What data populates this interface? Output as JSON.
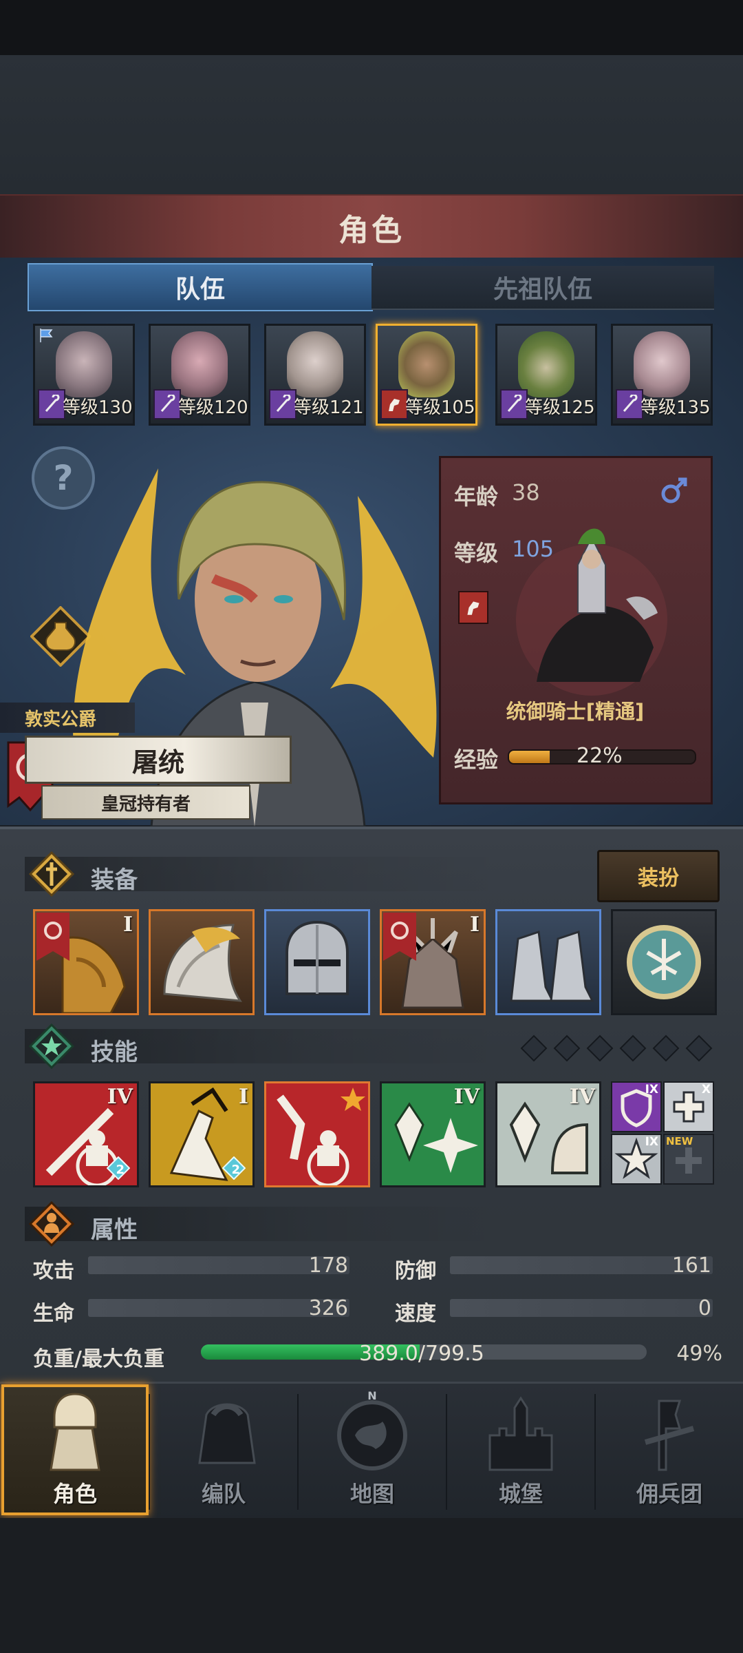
{
  "header": {
    "title": "角色"
  },
  "tabs": [
    {
      "label": "队伍",
      "active": true
    },
    {
      "label": "先祖队伍",
      "active": false
    }
  ],
  "team": [
    {
      "level": "等级130",
      "class_icon": "staff-icon",
      "selected": false,
      "flag": true
    },
    {
      "level": "等级120",
      "class_icon": "staff-icon",
      "selected": false,
      "flag": false
    },
    {
      "level": "等级121",
      "class_icon": "staff-icon",
      "selected": false,
      "flag": false
    },
    {
      "level": "等级105",
      "class_icon": "horse-icon",
      "selected": true,
      "flag": false
    },
    {
      "level": "等级125",
      "class_icon": "staff-icon",
      "selected": false,
      "flag": false
    },
    {
      "level": "等级135",
      "class_icon": "staff-icon",
      "selected": false,
      "flag": false
    }
  ],
  "hero": {
    "title": "敦实公爵",
    "name": "屠统",
    "subtitle": "皇冠持有者",
    "age_label": "年龄",
    "age": "38",
    "level_label": "等级",
    "level": "105",
    "class_name": "统御骑士[精通]",
    "exp_label": "经验",
    "exp_percent_text": "22%",
    "exp_fraction": 0.22
  },
  "equipment": {
    "title": "装备",
    "dress_button": "装扮",
    "items": [
      {
        "name": "dragon-armor",
        "tier": "I",
        "rarity": "orange"
      },
      {
        "name": "winged-shoulder",
        "tier": "",
        "rarity": "orange"
      },
      {
        "name": "knight-helmet",
        "tier": "",
        "rarity": "blue"
      },
      {
        "name": "spiked-armor",
        "tier": "I",
        "rarity": "orange"
      },
      {
        "name": "steel-boots",
        "tier": "",
        "rarity": "blue"
      },
      {
        "name": "emblem-medal",
        "tier": "",
        "rarity": "gray"
      }
    ]
  },
  "skills": {
    "title": "技能",
    "slots_total": 6,
    "items": [
      {
        "name": "sword-strike-skill",
        "tier": "IV",
        "badge": "2"
      },
      {
        "name": "broken-lance-skill",
        "tier": "I",
        "badge": "2"
      },
      {
        "name": "banner-rally-skill",
        "tier": "★",
        "badge": ""
      },
      {
        "name": "crystal-burst-skill",
        "tier": "IV",
        "badge": ""
      },
      {
        "name": "crystal-shield-skill",
        "tier": "IV",
        "badge": ""
      }
    ],
    "small": [
      {
        "name": "shield-passive",
        "tier": "IX"
      },
      {
        "name": "cross-passive",
        "tier": "X"
      },
      {
        "name": "burst-passive",
        "tier": "IX"
      },
      {
        "name": "new-empty-slot",
        "tier": "NEW"
      }
    ]
  },
  "attributes": {
    "title": "属性",
    "attack_label": "攻击",
    "attack": "178",
    "defense_label": "防御",
    "defense": "161",
    "hp_label": "生命",
    "hp": "326",
    "speed_label": "速度",
    "speed": "0",
    "load_label": "负重/最大负重",
    "load_text": "389.0/799.5",
    "load_percent_text": "49%",
    "load_fraction": 0.49
  },
  "nav": [
    {
      "label": "角色",
      "active": true
    },
    {
      "label": "编队",
      "active": false
    },
    {
      "label": "地图",
      "active": false
    },
    {
      "label": "城堡",
      "active": false
    },
    {
      "label": "佣兵团",
      "active": false
    }
  ],
  "compass_letter": "N",
  "colors": {
    "accent_gold": "#e8a030",
    "rare_blue": "#5a8ad8",
    "epic_orange": "#d8782a",
    "panel_red": "#5a3034"
  }
}
